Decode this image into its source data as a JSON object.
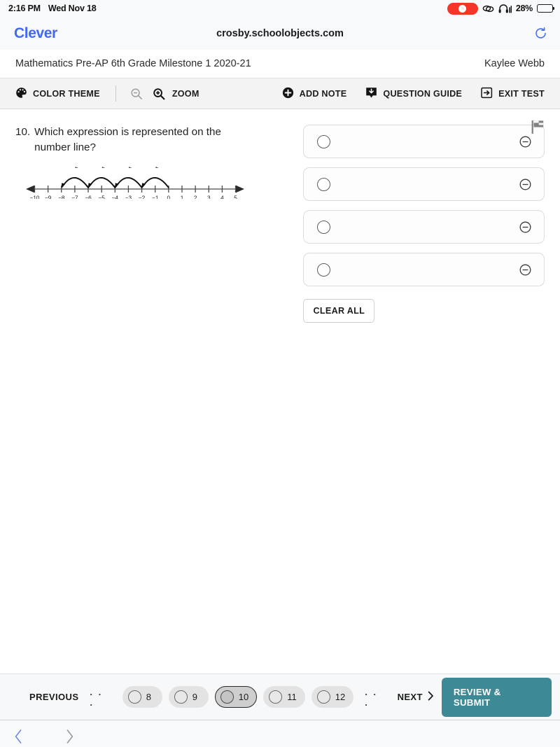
{
  "status_bar": {
    "time": "2:16 PM",
    "date": "Wed Nov 18",
    "recording_icon": "screen-record-icon",
    "link_icon": "link-icon",
    "headphones_icon": "headphones-icon",
    "battery_percent": "28%",
    "battery_level": 28
  },
  "browser": {
    "tab_label": "Clever",
    "url": "crosby.schoolobjects.com",
    "reload_icon": "reload-icon",
    "back_icon": "chevron-left-icon",
    "forward_icon": "chevron-right-icon"
  },
  "test_header": {
    "title": "Mathematics Pre-AP 6th Grade Milestone 1 2020-21",
    "student": "Kaylee Webb"
  },
  "toolbar": {
    "color_theme": "COLOR THEME",
    "zoom": "ZOOM",
    "add_note": "ADD NOTE",
    "question_guide": "QUESTION GUIDE",
    "exit_test": "EXIT TEST"
  },
  "question": {
    "number": "10.",
    "text": "Which expression is represented on the number line?",
    "flag_icon": "flag-icon",
    "clear_all": "CLEAR ALL",
    "choices": [
      {
        "label": "",
        "selected": false
      },
      {
        "label": "",
        "selected": false
      },
      {
        "label": "",
        "selected": false
      },
      {
        "label": "",
        "selected": false
      }
    ]
  },
  "chart_data": {
    "type": "number-line",
    "title": "",
    "xlabel": "",
    "ylabel": "",
    "xlim": [
      -10.6,
      5.6
    ],
    "ticks": [
      -10,
      -9,
      -8,
      -7,
      -6,
      -5,
      -4,
      -3,
      -2,
      -1,
      0,
      1,
      2,
      3,
      4,
      5
    ],
    "tick_labels": [
      "−10",
      "−9",
      "−8",
      "−7",
      "−6",
      "−5",
      "−4",
      "−3",
      "−2",
      "−1",
      "0",
      "1",
      "2",
      "3",
      "4",
      "5"
    ],
    "arrows_both_ends": true,
    "grid": false,
    "jumps": [
      {
        "from": 0,
        "to": -2,
        "label": "−2"
      },
      {
        "from": -2,
        "to": -4,
        "label": "−2"
      },
      {
        "from": -4,
        "to": -6,
        "label": "−2"
      },
      {
        "from": -6,
        "to": -8,
        "label": "−2"
      }
    ]
  },
  "bottom_nav": {
    "previous": "PREVIOUS",
    "next": "NEXT",
    "leading_dots": ". . .",
    "trailing_dots": ". . .",
    "review_submit": "REVIEW & SUBMIT",
    "questions": [
      {
        "n": "8",
        "current": false
      },
      {
        "n": "9",
        "current": false
      },
      {
        "n": "10",
        "current": true
      },
      {
        "n": "11",
        "current": false
      },
      {
        "n": "12",
        "current": false
      }
    ]
  },
  "colors": {
    "accent_teal": "#3d8a96",
    "link_blue": "#4268f6",
    "record_red": "#f53527"
  }
}
